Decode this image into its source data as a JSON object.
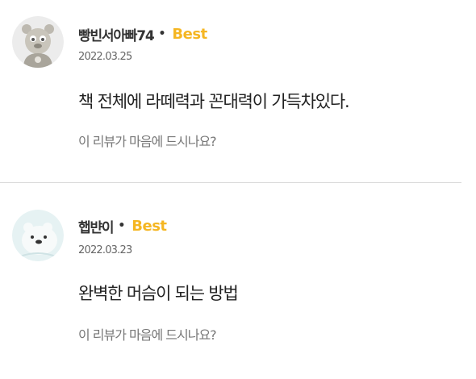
{
  "reviews": [
    {
      "nickname": "빵빈서아빠74",
      "separator": "•",
      "badge": "Best",
      "date": "2022.03.25",
      "text": "책 전체에 라떼력과 꼰대력이 가득차있다.",
      "helpful_prompt": "이 리뷰가 마음에 드시나요?",
      "avatar_icon": "bear-mascot-icon"
    },
    {
      "nickname": "햅뱐이",
      "separator": "•",
      "badge": "Best",
      "date": "2022.03.23",
      "text": "완벽한 머슴이 되는 방법",
      "helpful_prompt": "이 리뷰가 마음에 드시나요?",
      "avatar_icon": "polar-bear-icon"
    }
  ],
  "colors": {
    "best_badge": "#f5b622",
    "divider": "#d9d9d9",
    "muted_text": "#777777"
  }
}
